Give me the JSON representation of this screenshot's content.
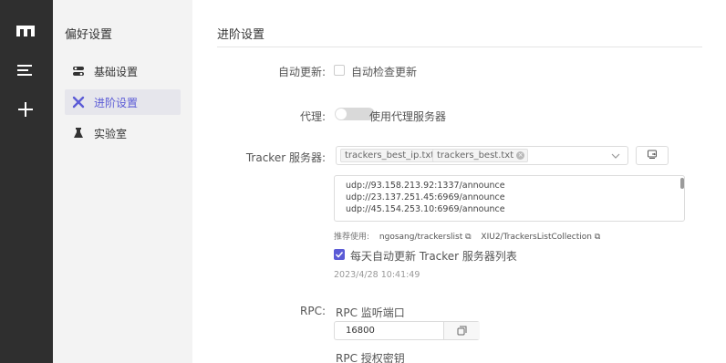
{
  "rail": {
    "icons": [
      "motrix-logo-icon",
      "menu-icon",
      "plus-icon"
    ]
  },
  "subnav": {
    "title": "偏好设置",
    "items": [
      {
        "label": "基础设置",
        "icon": "toggle-settings-icon",
        "active": false
      },
      {
        "label": "进阶设置",
        "icon": "tools-icon",
        "active": true
      },
      {
        "label": "实验室",
        "icon": "flask-icon",
        "active": false
      }
    ]
  },
  "main": {
    "title": "进阶设置",
    "auto_update": {
      "label": "自动更新:",
      "checkbox_label": "自动检查更新",
      "checked": false
    },
    "proxy": {
      "label": "代理:",
      "toggle_label": "使用代理服务器",
      "enabled": false
    },
    "tracker": {
      "label": "Tracker 服务器:",
      "selected": [
        "trackers_best_ip.txt",
        "trackers_best.txt"
      ],
      "servers": [
        "udp://93.158.213.92:1337/announce",
        "udp://23.137.251.45:6969/announce",
        "udp://45.154.253.10:6969/announce"
      ],
      "recommend_label": "推荐使用:",
      "recommend_links": [
        "ngosang/trackerslist",
        "XIU2/TrackersListCollection"
      ],
      "daily_update_label": "每天自动更新 Tracker 服务器列表",
      "daily_update_checked": true,
      "last_updated": "2023/4/28 10:41:49"
    },
    "rpc": {
      "label": "RPC:",
      "port_label": "RPC 监听端口",
      "port_value": "16800",
      "secret_label": "RPC 授权密钥"
    }
  },
  "colors": {
    "accent": "#5b5bd6",
    "rail_bg": "#2f2f2f",
    "subnav_bg": "#f3f3f3"
  }
}
